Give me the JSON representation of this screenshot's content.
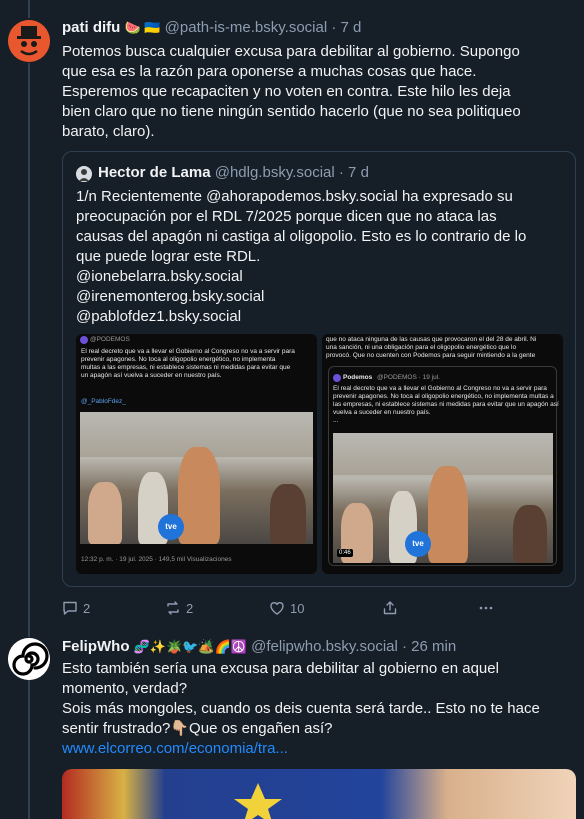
{
  "post1": {
    "author_name": "pati difu",
    "author_emoji": "🍉 🇺🇦",
    "handle": "@path-is-me.bsky.social",
    "time": "· 7 d",
    "text_lines": [
      "Potemos busca cualquier excusa para debilitar al gobierno. Supongo",
      "que esa es la razón para oponerse a muchas cosas que hace.",
      "Esperemos que recapaciten y no voten en contra. Este hilo les deja",
      "bien claro que no tiene ningún sentido hacerlo (que no sea politiqueo",
      "barato, claro)."
    ],
    "quote": {
      "author_name": "Hector de Lama",
      "handle": "@hdlg.bsky.social",
      "time": "· 7 d",
      "text_lines": [
        "1/n Recientemente @ahorapodemos.bsky.social ha expresado su",
        "preocupación por el RDL 7/2025 porque dicen que no ataca las",
        "causas del apagón ni castiga al oligopolio. Esto es lo contrario de lo",
        "que puede lograr este RDL.",
        "@ionebelarra.bsky.social",
        "@irenemonterog.bsky.social",
        "@pablofdez1.bsky.social"
      ],
      "image1": {
        "header": "@PODEMOS",
        "text_lines": [
          "El real decreto que va a llevar el Gobierno al Congreso no va a servir para",
          "prevenir apagones. No toca al oligopolio energético, no implementa",
          "multas a las empresas, ni establece sistemas ni medidas para evitar que",
          "un apagón así vuelva a suceder en nuestro país."
        ],
        "mention": "@_PabloFdez_",
        "footer": "12:32 p. m. · 19 jul. 2025 · 149,5 mil Visualizaciones",
        "logo": "tve"
      },
      "image2": {
        "top_lines": [
          "que no ataca ninguna de las causas que provocaron el del 28 de abril. Ni",
          "una sanción, ni una obligación para el oligopolio energético que lo",
          "provocó. Que no cuenten con Podemos para seguir mintiendo a la gente"
        ],
        "inner_name": "Podemos",
        "inner_handle": "@PODEMOS · 19 jul.",
        "inner_lines": [
          "El real decreto que va a llevar el Gobierno al Congreso no va a servir para",
          "prevenir apagones. No toca al oligopolio energético, no implementa multas a",
          "las empresas, ni establece sistemas ni medidas para evitar que un apagón así",
          "vuelva a suceder en nuestro país.",
          "..."
        ],
        "duration": "0:46",
        "logo": "tve"
      }
    },
    "actions": {
      "replies": "2",
      "reposts": "2",
      "likes": "10"
    }
  },
  "post2": {
    "author_name": "FelipWho",
    "author_emoji": "🧬✨🪴🐦🏕️🌈☮️",
    "handle": "@felipwho.bsky.social",
    "time": "· 26 min",
    "text_lines": [
      "Esto también sería una excusa para debilitar al gobierno en aquel",
      "momento, verdad?",
      "Sois más mongoles, cuando os deis cuenta será tarde.. Esto no te hace",
      "sentir frustrado?👇🏼Que os engañen así?"
    ],
    "link": "www.elcorreo.com/economia/tra..."
  },
  "icons": [
    "reply-icon",
    "repost-icon",
    "like-icon",
    "share-icon",
    "more-icon"
  ],
  "colors": {
    "background": "#161e27",
    "text": "#f1f3f5",
    "muted": "#8d9cb0",
    "link": "#208bfe",
    "border": "#2e4052"
  }
}
